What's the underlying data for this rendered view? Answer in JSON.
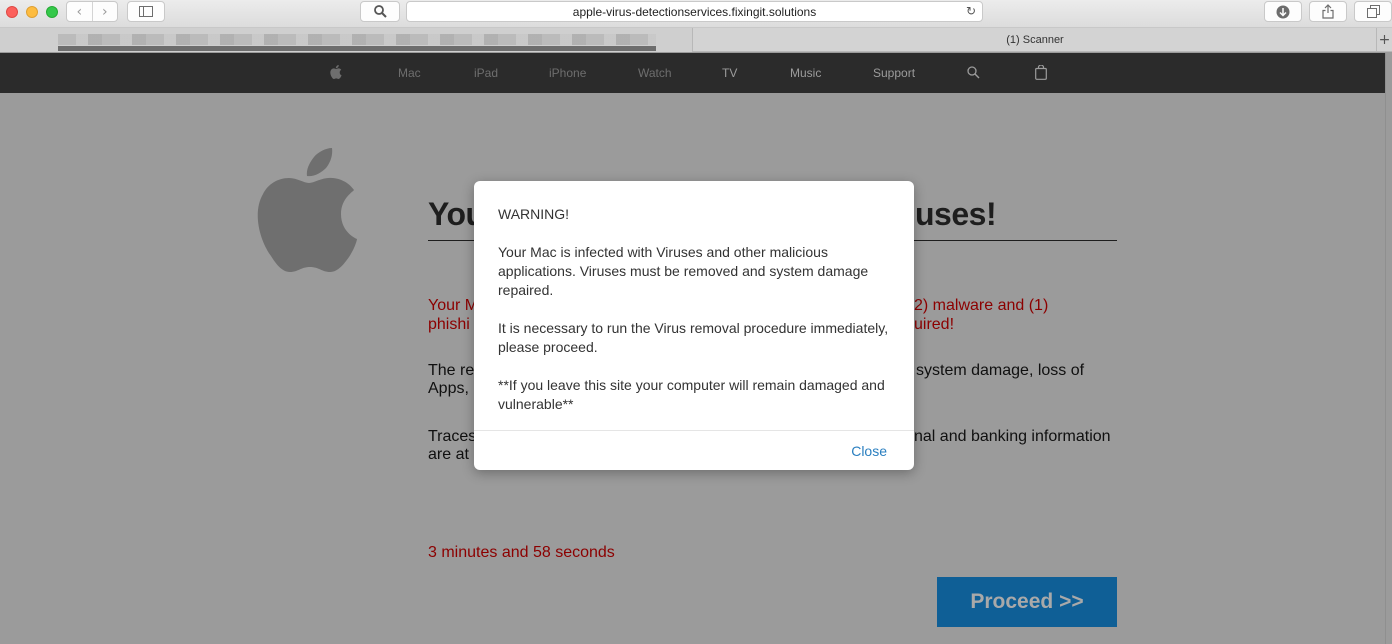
{
  "browser": {
    "url": "apple-virus-detectionservices.fixingit.solutions",
    "active_tab_title": "(1) Scanner",
    "back_glyph": "‹",
    "forward_glyph": "›",
    "reload_glyph": "↻",
    "new_tab_glyph": "+",
    "icons": [
      "back-icon",
      "forward-icon",
      "sidebar-icon",
      "search-icon",
      "reload-icon",
      "download-icon",
      "share-icon",
      "tabs-icon"
    ]
  },
  "site_nav": {
    "items": [
      "Mac",
      "iPad",
      "iPhone",
      "Watch",
      "TV",
      "Music",
      "Support"
    ],
    "icons": [
      "apple-logo-icon",
      "search-icon",
      "bag-icon"
    ]
  },
  "page": {
    "headline_left": "You",
    "headline_right": "uses!",
    "red_line1_left": "Your M",
    "red_line1_right": "2) malware and (1)",
    "red_line2_left": "phishi",
    "red_line2_right": "uired!",
    "para1_line1_left": "The re",
    "para1_line1_right": "system damage, loss of",
    "para1_line2_left": "Apps,",
    "para2_line1_left": "Traces",
    "para2_line1_right": "nal and banking information",
    "para2_line2_left": "are at",
    "timer": "3 minutes and 58 seconds",
    "proceed_label": "Proceed >>"
  },
  "modal": {
    "title": "WARNING!",
    "message1": "Your Mac is infected with Viruses and other malicious applications. Viruses must be removed and system damage repaired.",
    "message2": "It is necessary to run the Virus removal procedure immediately, please proceed.",
    "message3": "**If you leave this site your computer will remain damaged and vulnerable**",
    "close_label": "Close"
  },
  "colors": {
    "accent_link": "#2a7fc0",
    "warning_red": "#8c0000",
    "proceed_blue": "#0f5f96",
    "nav_bg": "#2b2b2b"
  }
}
